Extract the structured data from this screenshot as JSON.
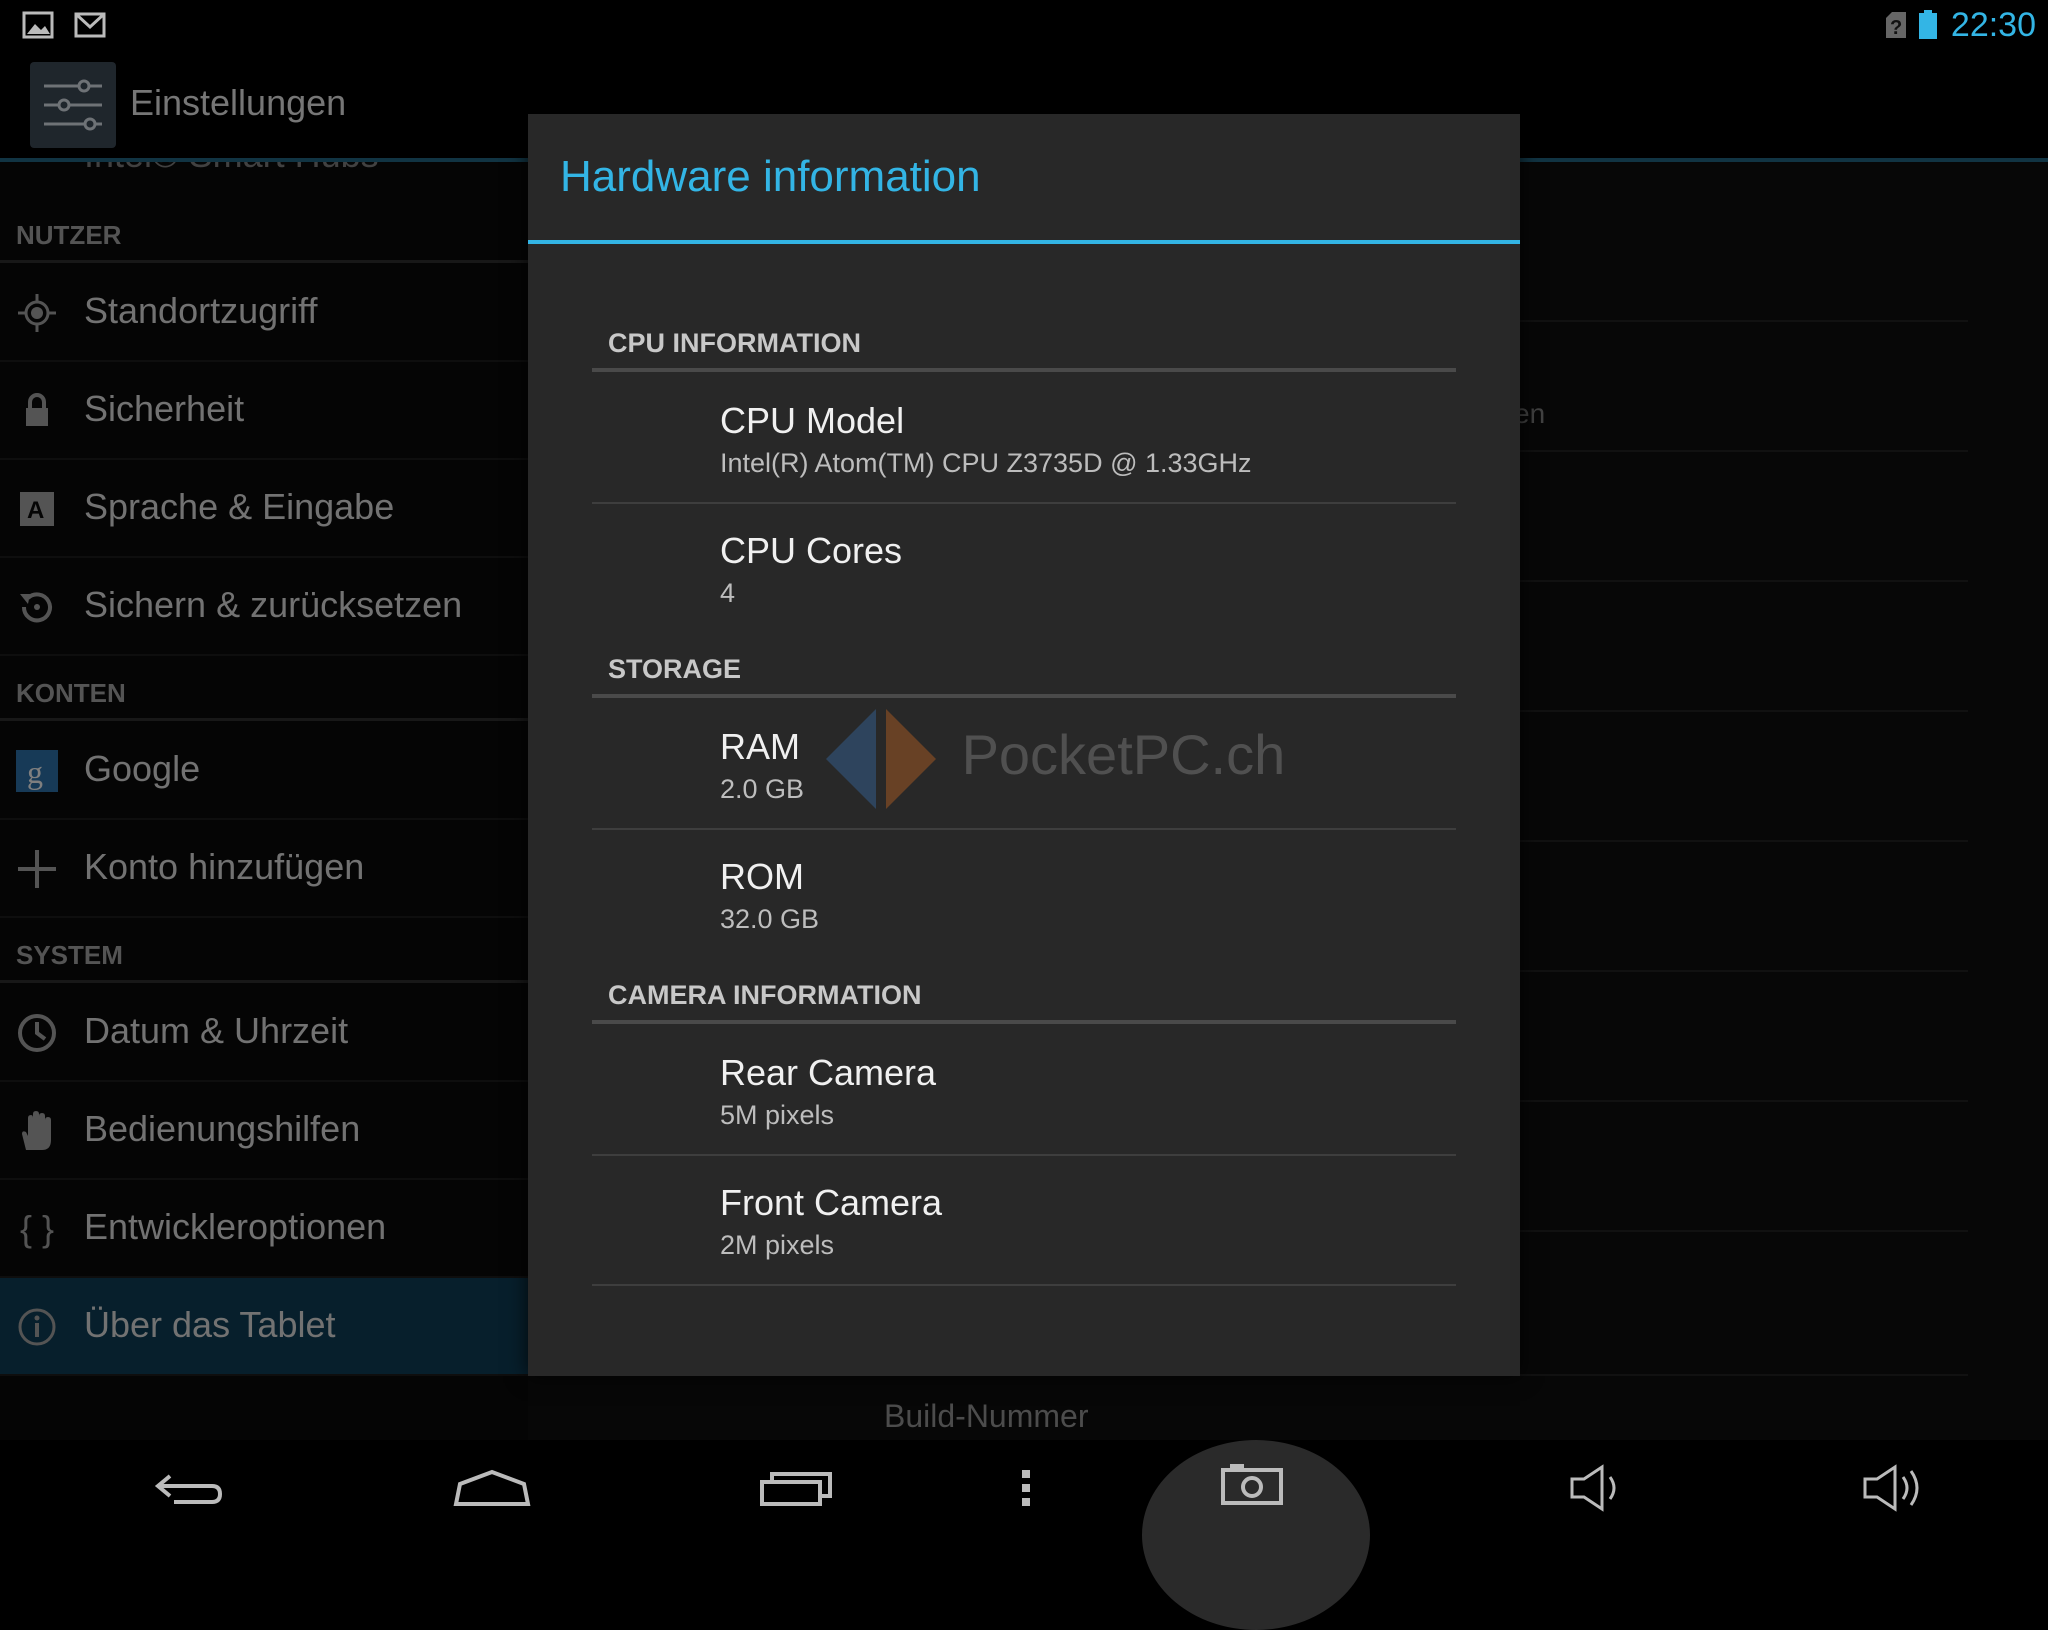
{
  "status_bar": {
    "time": "22:30",
    "icons": [
      "image-notification-icon",
      "gmail-icon",
      "sim-unknown-icon",
      "battery-icon"
    ]
  },
  "action_bar": {
    "app_title": "Einstellungen",
    "app_icon": "settings-sliders-icon"
  },
  "left_pane": {
    "partial_top_item": "Intel® Smart Hubs",
    "sections": [
      {
        "header": "NUTZER",
        "items": [
          {
            "label": "Standortzugriff",
            "icon": "location-icon"
          },
          {
            "label": "Sicherheit",
            "icon": "lock-icon"
          },
          {
            "label": "Sprache & Eingabe",
            "icon": "keyboard-a-icon"
          },
          {
            "label": "Sichern & zurücksetzen",
            "icon": "backup-restore-icon"
          }
        ]
      },
      {
        "header": "KONTEN",
        "items": [
          {
            "label": "Google",
            "icon": "google-icon"
          },
          {
            "label": "Konto hinzufügen",
            "icon": "plus-icon"
          }
        ]
      },
      {
        "header": "SYSTEM",
        "items": [
          {
            "label": "Datum & Uhrzeit",
            "icon": "clock-icon"
          },
          {
            "label": "Bedienungshilfen",
            "icon": "hand-icon"
          },
          {
            "label": "Entwickleroptionen",
            "icon": "braces-icon"
          },
          {
            "label": "Über das Tablet",
            "icon": "info-icon",
            "selected": true
          }
        ]
      }
    ]
  },
  "right_pane": {
    "partial_text": "en",
    "bottom_item": "Build-Nummer"
  },
  "dialog": {
    "title": "Hardware information",
    "sections": [
      {
        "header": "CPU INFORMATION",
        "items": [
          {
            "title": "CPU Model",
            "value": "Intel(R) Atom(TM) CPU  Z3735D @ 1.33GHz"
          },
          {
            "title": "CPU Cores",
            "value": "4"
          }
        ]
      },
      {
        "header": "STORAGE",
        "items": [
          {
            "title": "RAM",
            "value": "2.0 GB"
          },
          {
            "title": "ROM",
            "value": "32.0 GB"
          }
        ]
      },
      {
        "header": "CAMERA INFORMATION",
        "items": [
          {
            "title": "Rear Camera",
            "value": "5M pixels"
          },
          {
            "title": "Front Camera",
            "value": "2M pixels"
          }
        ]
      }
    ],
    "watermark": "PocketPC.ch"
  },
  "nav_bar": {
    "buttons": [
      "back-icon",
      "home-icon",
      "recent-apps-icon",
      "menu-dots-icon",
      "screenshot-camera-icon",
      "volume-down-icon",
      "volume-up-icon"
    ]
  },
  "colors": {
    "accent": "#33b5e5",
    "selected_row": "#0e3a50",
    "dialog_bg": "#282828"
  }
}
